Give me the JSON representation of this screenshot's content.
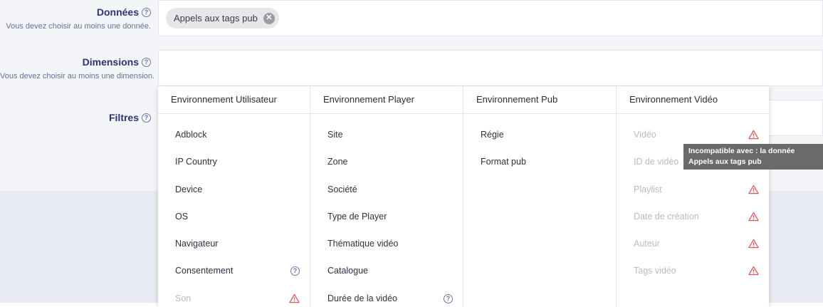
{
  "donnees": {
    "label": "Données",
    "hint": "Vous devez choisir au moins une donnée.",
    "chip": "Appels aux tags pub"
  },
  "dimensions": {
    "label": "Dimensions",
    "hint": "Vous devez choisir au moins une dimension."
  },
  "filtres": {
    "label": "Filtres"
  },
  "dropdown": {
    "columns": [
      {
        "header": "Environnement Utilisateur",
        "items": [
          {
            "label": "Adblock"
          },
          {
            "label": "IP Country"
          },
          {
            "label": "Device"
          },
          {
            "label": "OS"
          },
          {
            "label": "Navigateur"
          },
          {
            "label": "Consentement",
            "icon": "help-icon"
          },
          {
            "label": "Son",
            "icon": "warning-icon",
            "disabled": true
          }
        ]
      },
      {
        "header": "Environnement Player",
        "items": [
          {
            "label": "Site"
          },
          {
            "label": "Zone"
          },
          {
            "label": "Société"
          },
          {
            "label": "Type de Player"
          },
          {
            "label": "Thématique vidéo"
          },
          {
            "label": "Catalogue"
          },
          {
            "label": "Durée de la vidéo",
            "icon": "help-icon"
          }
        ]
      },
      {
        "header": "Environnement Pub",
        "items": [
          {
            "label": "Régie"
          },
          {
            "label": "Format pub"
          }
        ]
      },
      {
        "header": "Environnement Vidéo",
        "items": [
          {
            "label": "Vidéo",
            "icon": "warning-icon",
            "disabled": true
          },
          {
            "label": "ID de vidéo",
            "disabled": true
          },
          {
            "label": "Playlist",
            "icon": "warning-icon",
            "disabled": true
          },
          {
            "label": "Date de création",
            "icon": "warning-icon",
            "disabled": true
          },
          {
            "label": "Auteur",
            "icon": "warning-icon",
            "disabled": true
          },
          {
            "label": "Tags vidéo",
            "icon": "warning-icon",
            "disabled": true
          }
        ]
      }
    ]
  },
  "tooltip": "Incompatible avec : la donnée Appels aux tags pub",
  "colors": {
    "label": "#2d3278",
    "warning": "#e05a5a",
    "help": "#6f73a8"
  }
}
